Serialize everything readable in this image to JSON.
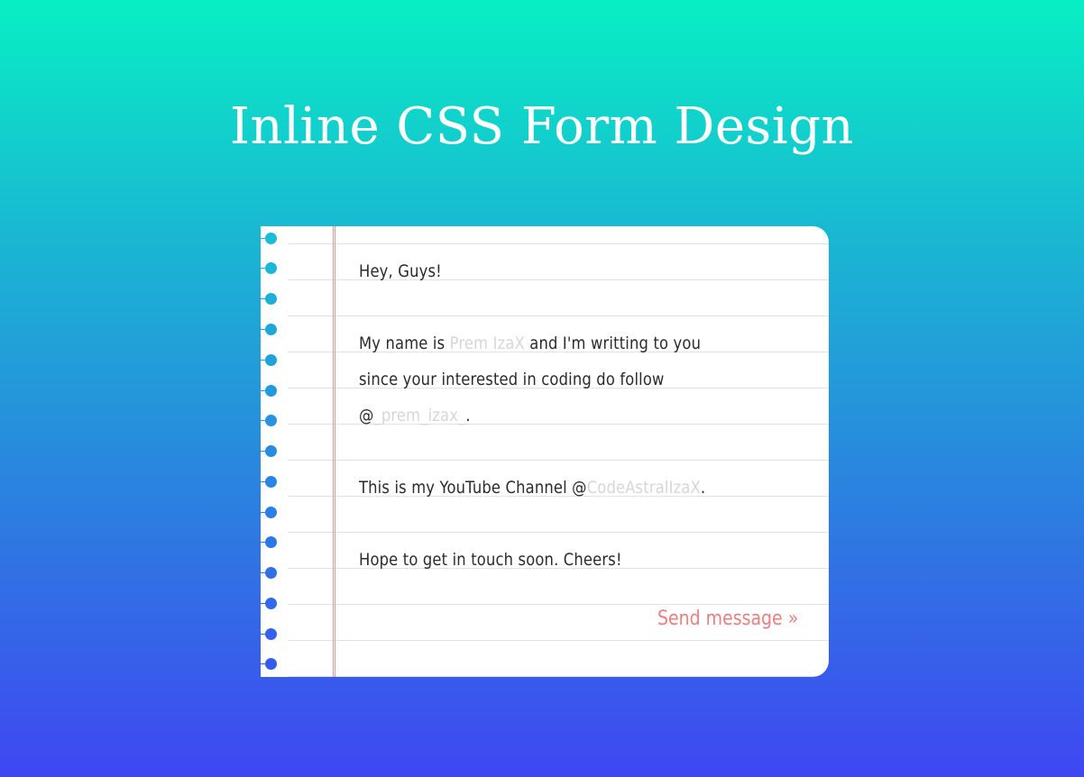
{
  "page": {
    "title": "Inline CSS Form Design"
  },
  "letter": {
    "greeting": "Hey, Guys!",
    "intro_prefix": "My name is",
    "name_value": "Prem IzaX",
    "intro_middle": "and I'm writting to you since your interested in coding do follow @",
    "handle_value": "_prem_izax_",
    "intro_suffix": ".",
    "channel_prefix": "This is my YouTube Channel @",
    "channel_value": "CodeAstralIzaX",
    "channel_suffix": ".",
    "closing": "Hope to get in touch soon. Cheers!"
  },
  "form": {
    "send_label": "Send message »"
  },
  "colors": {
    "gradient_top": "#08efc4",
    "gradient_bottom": "#3f47f2",
    "paper": "#ffffff",
    "margin_line": "#d49a9a",
    "send": "#e88080",
    "placeholder": "#d6d6d6"
  }
}
